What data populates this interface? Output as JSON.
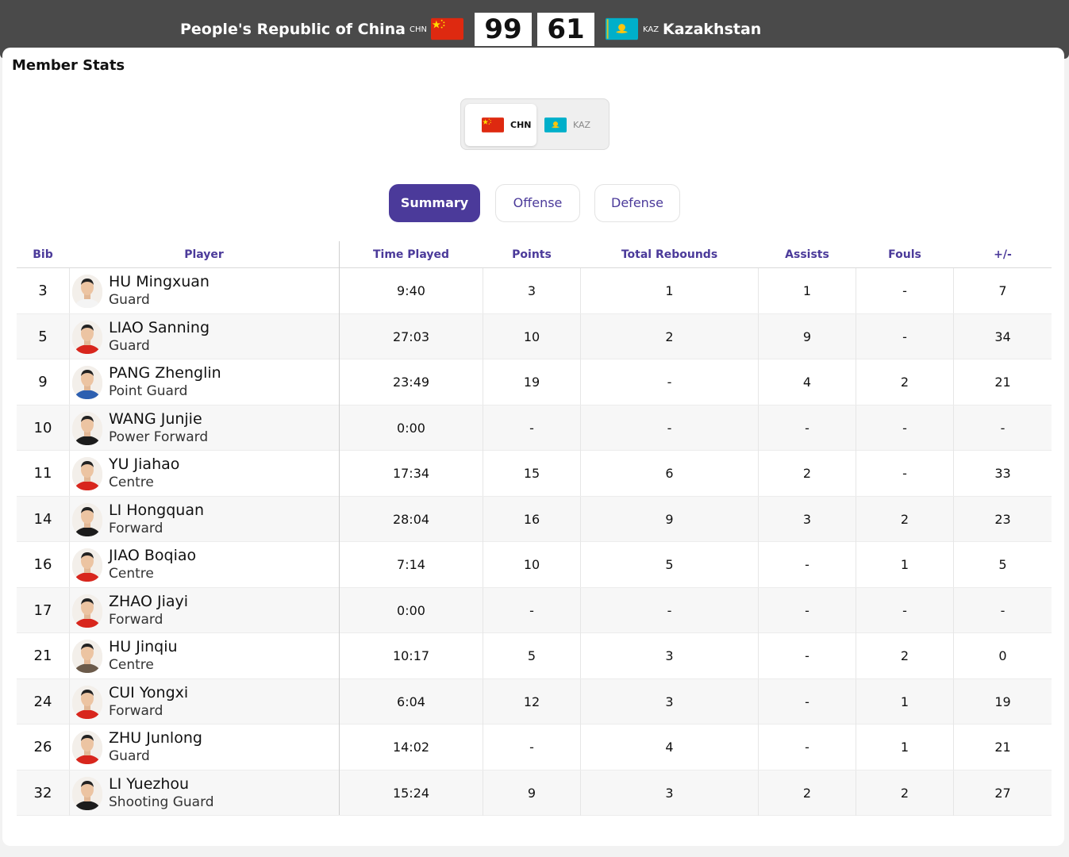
{
  "header": {
    "home_team": "People's Republic of China",
    "home_code": "CHN",
    "home_score": "99",
    "away_score": "61",
    "away_code": "KAZ",
    "away_team": "Kazakhstan"
  },
  "section_title": "Member Stats",
  "team_switch": {
    "active": "CHN",
    "inactive": "KAZ"
  },
  "tabs": {
    "summary": "Summary",
    "offense": "Offense",
    "defense": "Defense"
  },
  "columns": {
    "bib": "Bib",
    "player": "Player",
    "time": "Time Played",
    "points": "Points",
    "rebounds": "Total Rebounds",
    "assists": "Assists",
    "fouls": "Fouls",
    "plusminus": "+/-"
  },
  "players": [
    {
      "bib": "3",
      "name": "HU Mingxuan",
      "pos": "Guard",
      "time": "9:40",
      "pts": "3",
      "reb": "1",
      "ast": "1",
      "fls": "-",
      "pm": "7",
      "jersey": "white"
    },
    {
      "bib": "5",
      "name": "LIAO Sanning",
      "pos": "Guard",
      "time": "27:03",
      "pts": "10",
      "reb": "2",
      "ast": "9",
      "fls": "-",
      "pm": "34",
      "jersey": "red"
    },
    {
      "bib": "9",
      "name": "PANG Zhenglin",
      "pos": "Point Guard",
      "time": "23:49",
      "pts": "19",
      "reb": "-",
      "ast": "4",
      "fls": "2",
      "pm": "21",
      "jersey": "blue"
    },
    {
      "bib": "10",
      "name": "WANG Junjie",
      "pos": "Power Forward",
      "time": "0:00",
      "pts": "-",
      "reb": "-",
      "ast": "-",
      "fls": "-",
      "pm": "-",
      "jersey": "black"
    },
    {
      "bib": "11",
      "name": "YU Jiahao",
      "pos": "Centre",
      "time": "17:34",
      "pts": "15",
      "reb": "6",
      "ast": "2",
      "fls": "-",
      "pm": "33",
      "jersey": "red"
    },
    {
      "bib": "14",
      "name": "LI Hongquan",
      "pos": "Forward",
      "time": "28:04",
      "pts": "16",
      "reb": "9",
      "ast": "3",
      "fls": "2",
      "pm": "23",
      "jersey": "black"
    },
    {
      "bib": "16",
      "name": "JIAO Boqiao",
      "pos": "Centre",
      "time": "7:14",
      "pts": "10",
      "reb": "5",
      "ast": "-",
      "fls": "1",
      "pm": "5",
      "jersey": "red"
    },
    {
      "bib": "17",
      "name": "ZHAO Jiayi",
      "pos": "Forward",
      "time": "0:00",
      "pts": "-",
      "reb": "-",
      "ast": "-",
      "fls": "-",
      "pm": "-",
      "jersey": "red"
    },
    {
      "bib": "21",
      "name": "HU Jinqiu",
      "pos": "Centre",
      "time": "10:17",
      "pts": "5",
      "reb": "3",
      "ast": "-",
      "fls": "2",
      "pm": "0",
      "jersey": "brown"
    },
    {
      "bib": "24",
      "name": "CUI Yongxi",
      "pos": "Forward",
      "time": "6:04",
      "pts": "12",
      "reb": "3",
      "ast": "-",
      "fls": "1",
      "pm": "19",
      "jersey": "red"
    },
    {
      "bib": "26",
      "name": "ZHU Junlong",
      "pos": "Guard",
      "time": "14:02",
      "pts": "-",
      "reb": "4",
      "ast": "-",
      "fls": "1",
      "pm": "21",
      "jersey": "red"
    },
    {
      "bib": "32",
      "name": "LI Yuezhou",
      "pos": "Shooting Guard",
      "time": "15:24",
      "pts": "9",
      "reb": "3",
      "ast": "2",
      "fls": "2",
      "pm": "27",
      "jersey": "black"
    }
  ],
  "colors": {
    "accent": "#4b3a9a",
    "header_bg": "#4a4a4a",
    "china_red": "#de2910",
    "china_yellow": "#ffde00",
    "kazakh_blue": "#00afca",
    "kazakh_gold": "#fec50c"
  }
}
